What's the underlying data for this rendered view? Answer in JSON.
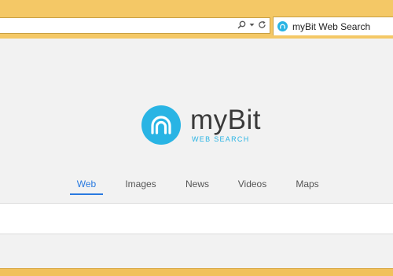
{
  "browser": {
    "tab_title": "myBit Web Search",
    "address_icons": [
      "search-icon",
      "dropdown-arrow-icon",
      "refresh-icon"
    ],
    "frame_color": "#f1c15c"
  },
  "page": {
    "logo": {
      "name": "myBit",
      "subtitle": "WEB SEARCH",
      "brand_color": "#29b4e4"
    },
    "tabs": [
      {
        "label": "Web",
        "active": true
      },
      {
        "label": "Images",
        "active": false
      },
      {
        "label": "News",
        "active": false
      },
      {
        "label": "Videos",
        "active": false
      },
      {
        "label": "Maps",
        "active": false
      }
    ],
    "active_tab_color": "#2a7ae0"
  }
}
